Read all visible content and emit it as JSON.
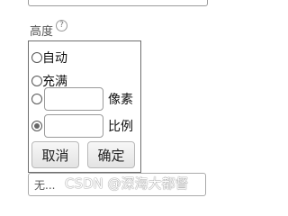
{
  "height_section": {
    "label": "高度",
    "help_icon_text": "?",
    "options": {
      "auto": "自动",
      "fill": "充满",
      "pixels": {
        "value": "",
        "unit": "像素"
      },
      "ratio": {
        "value": "",
        "unit": "比例"
      }
    },
    "selected": "ratio",
    "buttons": {
      "cancel": "取消",
      "confirm": "确定"
    }
  },
  "bottom_field": {
    "value": "无..."
  },
  "watermark": "CSDN @深海大都督"
}
